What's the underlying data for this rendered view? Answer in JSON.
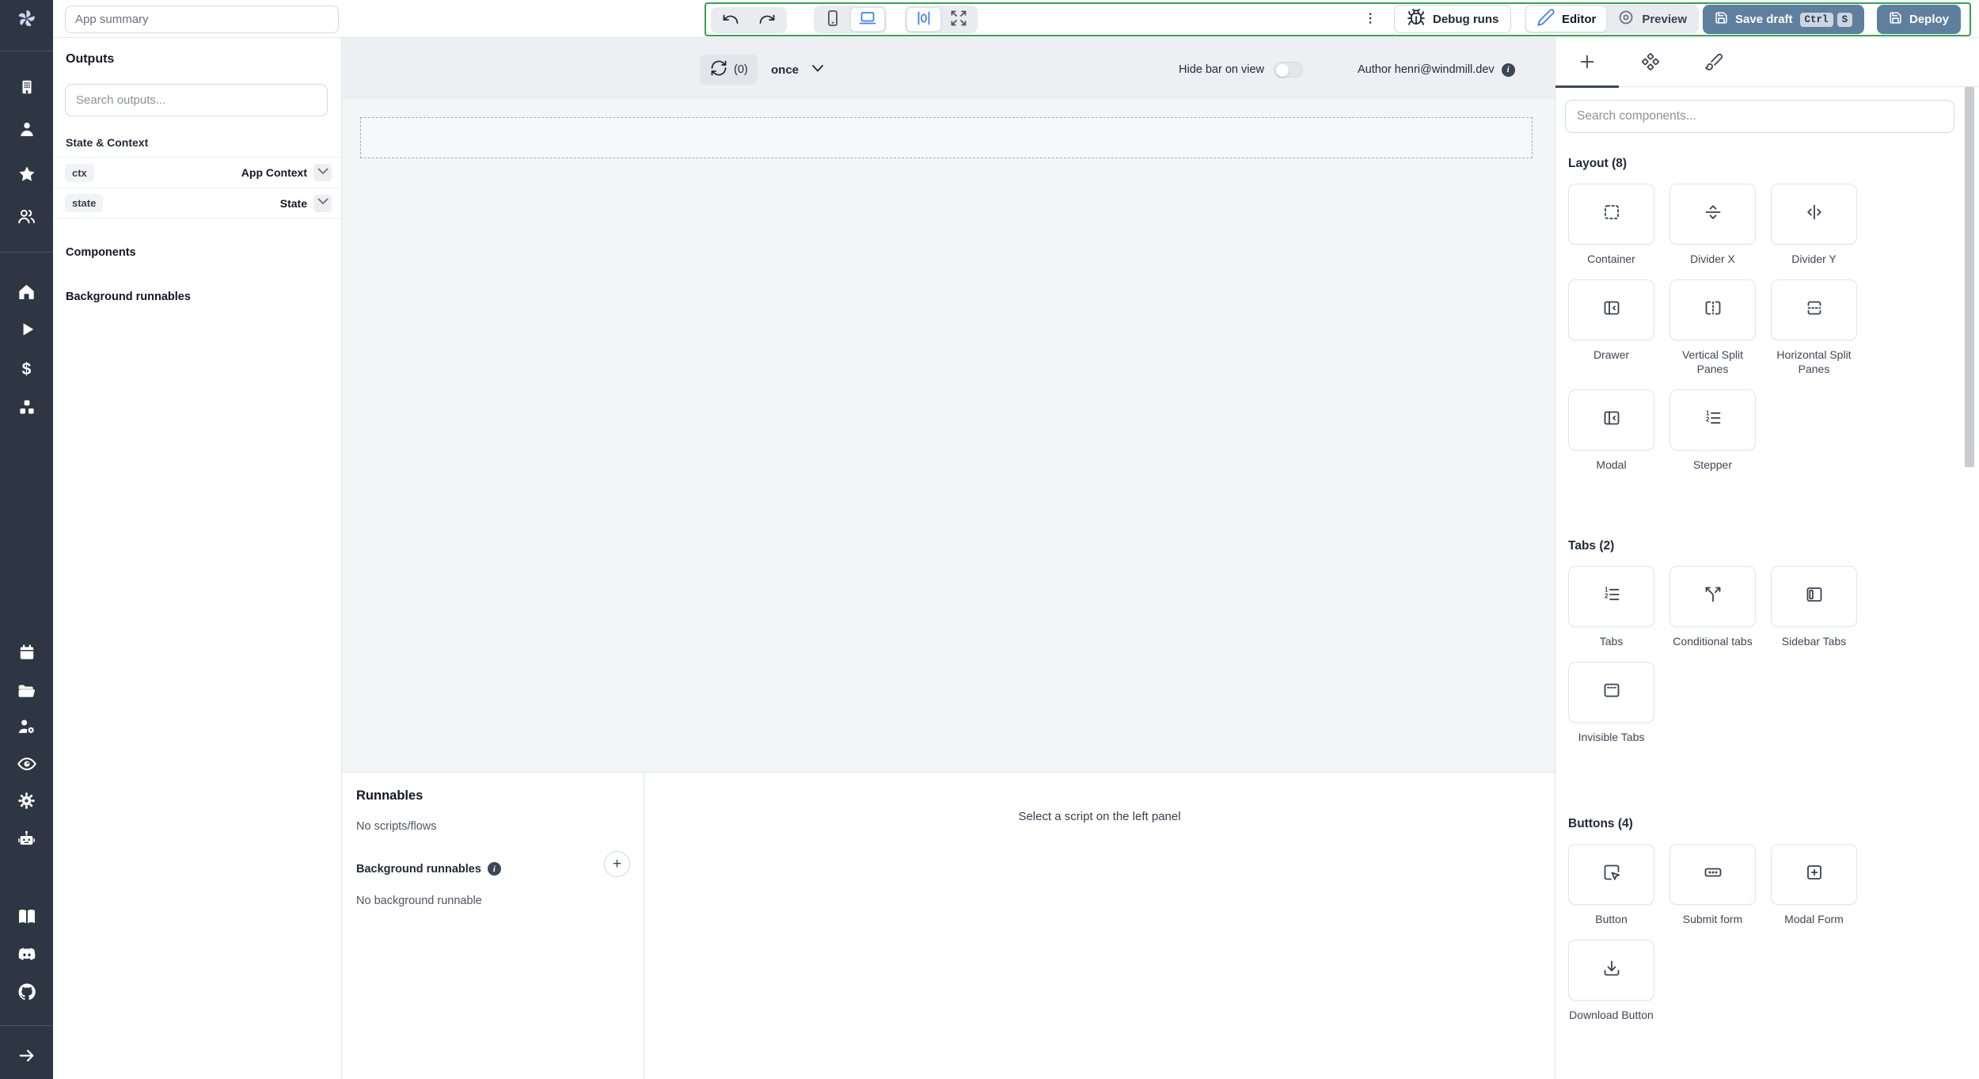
{
  "colors": {
    "record_border_green": "#2fa44f",
    "primary_button_blue": "#5f7f9f",
    "accent_icon_blue": "#3b82f6",
    "sidebar_bg": "#2e3644"
  },
  "header": {
    "app_summary_placeholder": "App summary",
    "debug_runs_label": "Debug runs",
    "editor_label": "Editor",
    "preview_label": "Preview",
    "save_draft_label": "Save draft",
    "kbd_ctrl": "Ctrl",
    "kbd_s": "S",
    "deploy_label": "Deploy"
  },
  "sidebar": {
    "icons": [
      "building-icon",
      "user-icon",
      "star-icon",
      "users-icon",
      "home-icon",
      "play-icon",
      "dollar-icon",
      "boxes-icon",
      "calendar-icon",
      "folder-icon",
      "user-cog-icon",
      "eye-icon",
      "settings-icon",
      "bot-icon",
      "book-icon",
      "discord-icon",
      "github-icon",
      "arrow-right-icon"
    ]
  },
  "left_panel": {
    "outputs_title": "Outputs",
    "search_placeholder": "Search outputs...",
    "state_context_title": "State & Context",
    "rows": [
      {
        "key": "ctx",
        "label": "App Context"
      },
      {
        "key": "state",
        "label": "State"
      }
    ],
    "components_title": "Components",
    "background_title": "Background runnables"
  },
  "canvas": {
    "refresh_count": "(0)",
    "refresh_mode": "once",
    "hide_bar_label": "Hide bar on view",
    "author_label": "Author henri@windmill.dev"
  },
  "runnables": {
    "title": "Runnables",
    "empty_scripts": "No scripts/flows",
    "background_title": "Background runnables",
    "empty_background": "No background runnable",
    "select_hint": "Select a script on the left panel"
  },
  "components_panel": {
    "search_placeholder": "Search components...",
    "sections": [
      {
        "title": "Layout (8)",
        "items": [
          {
            "label": "Container",
            "icon": "container-icon"
          },
          {
            "label": "Divider X",
            "icon": "divider-x-icon"
          },
          {
            "label": "Divider Y",
            "icon": "divider-y-icon"
          },
          {
            "label": "Drawer",
            "icon": "drawer-icon"
          },
          {
            "label": "Vertical Split Panes",
            "icon": "vertical-split-icon"
          },
          {
            "label": "Horizontal Split Panes",
            "icon": "horizontal-split-icon"
          },
          {
            "label": "Modal",
            "icon": "modal-icon"
          },
          {
            "label": "Stepper",
            "icon": "stepper-icon"
          }
        ]
      },
      {
        "title": "Tabs (2)",
        "items": [
          {
            "label": "Tabs",
            "icon": "tabs-icon"
          },
          {
            "label": "Conditional tabs",
            "icon": "conditional-tabs-icon"
          },
          {
            "label": "Sidebar Tabs",
            "icon": "sidebar-tabs-icon"
          },
          {
            "label": "Invisible Tabs",
            "icon": "invisible-tabs-icon"
          }
        ]
      },
      {
        "title": "Buttons (4)",
        "items": [
          {
            "label": "Button",
            "icon": "button-icon"
          },
          {
            "label": "Submit form",
            "icon": "submit-form-icon"
          },
          {
            "label": "Modal Form",
            "icon": "modal-form-icon"
          },
          {
            "label": "Download Button",
            "icon": "download-icon"
          }
        ]
      }
    ]
  }
}
